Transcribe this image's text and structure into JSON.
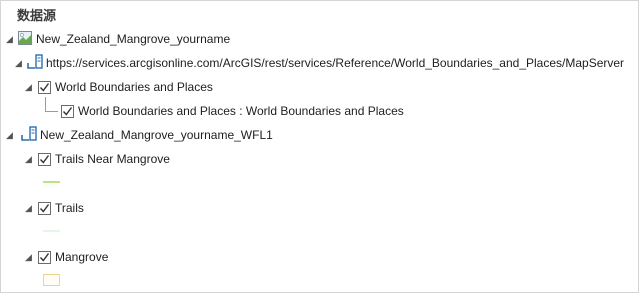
{
  "panel": {
    "title": "数据源"
  },
  "tree": {
    "map": {
      "label": "New_Zealand_Mangrove_yourname",
      "icon": "map-icon"
    },
    "service": {
      "label": "https://services.arcgisonline.com/ArcGIS/rest/services/Reference/World_Boundaries_and_Places/MapServer",
      "icon": "server-icon"
    },
    "group_layer": {
      "label": "World Boundaries and Places",
      "checked": true
    },
    "sub_layer": {
      "label": "World Boundaries and Places : World Boundaries and Places",
      "checked": true
    },
    "feature_service": {
      "label": "New_Zealand_Mangrove_yourname_WFL1",
      "icon": "server-icon"
    },
    "layers": [
      {
        "label": "Trails Near Mangrove",
        "checked": true,
        "symbol": "line",
        "color": "#b8e878"
      },
      {
        "label": "Trails",
        "checked": true,
        "symbol": "line",
        "color": "#e6f6e6"
      },
      {
        "label": "Mangrove",
        "checked": true,
        "symbol": "polygon",
        "color": "#f3d28a"
      }
    ]
  }
}
